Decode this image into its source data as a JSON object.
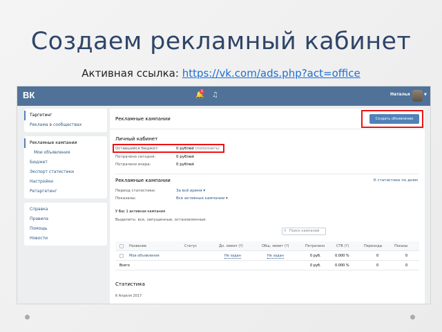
{
  "slide": {
    "title": "Создаем рекламный кабинет",
    "subtitle_prefix": "Активная ссылка: ",
    "link": "https://vk.com/ads.php?act=office"
  },
  "header": {
    "logo": "ВК",
    "bell_badge": "1",
    "user_name": "Наталья"
  },
  "sidebar": {
    "group1": [
      "Таргетинг",
      "Реклама в сообществах"
    ],
    "group2": [
      "Рекламные кампании",
      "Мои объявления",
      "Бюджет",
      "Экспорт статистики",
      "Настройки",
      "Ретаргетинг"
    ],
    "group3": [
      "Справка",
      "Правила",
      "Помощь",
      "Новости"
    ]
  },
  "main": {
    "title": "Рекламные кампании",
    "create_button": "Создать объявление",
    "cabinet": {
      "title": "Личный кабинет",
      "rows": [
        {
          "label": "Оставшийся бюджет:",
          "value": "0 рублей",
          "extra": "(пополнить)"
        },
        {
          "label": "Потрачено сегодня:",
          "value": "0 рублей",
          "extra": ""
        },
        {
          "label": "Потрачено вчера:",
          "value": "0 рублей",
          "extra": ""
        }
      ]
    },
    "campaigns": {
      "title": "Рекламные кампании",
      "stats_link": "К статистике по дням",
      "period_label": "Период статистики:",
      "period_value": "За всё время",
      "shown_label": "Показаны:",
      "shown_value": "Все активные кампании",
      "count_text": "У Вас 1 активная кампания",
      "filter_text": "Выделить: все, запущенные, остановленные",
      "search_placeholder": "Поиск кампаний"
    },
    "table": {
      "headers": [
        "Название",
        "Статус",
        "Дн. лимит (?)",
        "Общ. лимит (?)",
        "Потрачено",
        "CTR (?)",
        "Переходы",
        "Показы"
      ],
      "row": [
        "Мои объявления",
        "",
        "Не задан",
        "Не задан",
        "0 руб.",
        "0.000 %",
        "0",
        "0"
      ],
      "total": [
        "Всего",
        "",
        "",
        "",
        "0 руб.",
        "0.000 %",
        "0",
        "0"
      ]
    },
    "stats": {
      "title": "Статистика",
      "date": "6 Апреля 2017"
    }
  },
  "colors": {
    "vk_blue": "#507299",
    "button_blue": "#5181b8",
    "highlight_red": "#ee1111",
    "title_navy": "#2f4569"
  }
}
